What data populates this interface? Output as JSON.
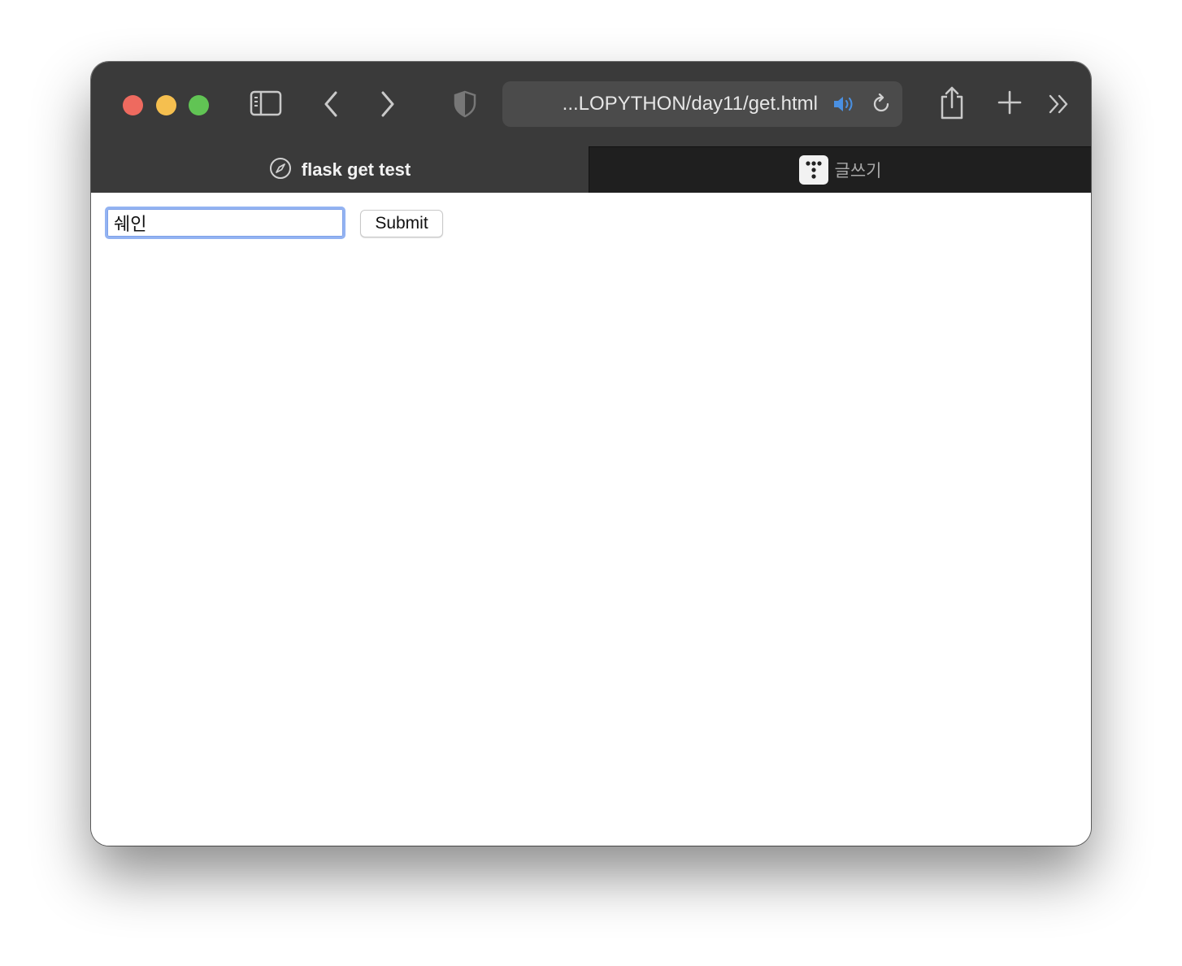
{
  "browser": {
    "address_bar": {
      "url": "...LOPYTHON/day11/get.html",
      "audio_icon": "speaker-wave-icon",
      "reload_icon": "reload-icon"
    },
    "toolbar_icons": [
      "sidebar-icon",
      "back-chevron-icon",
      "forward-chevron-icon",
      "privacy-shield-icon",
      "share-icon",
      "new-tab-plus-icon",
      "more-chevron-icon"
    ],
    "accent_color": "#4a90e2"
  },
  "tabs": [
    {
      "label": "flask get test",
      "icon": "compass-icon",
      "active": true
    },
    {
      "label": "글쓰기",
      "icon": "tistory-dots-icon",
      "active": false
    }
  ],
  "page": {
    "form": {
      "input_value": "쉐인",
      "submit_label": "Submit"
    }
  }
}
